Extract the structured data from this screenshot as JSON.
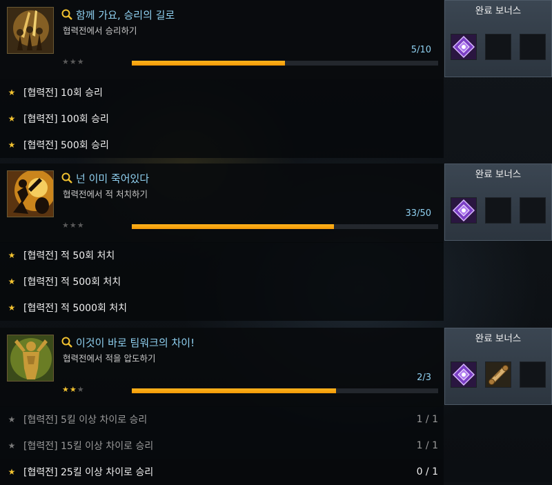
{
  "colors": {
    "accent_title": "#8fd0f0",
    "progress_fill": "#f29a08",
    "star_on": "#f2c230",
    "star_off": "#5a5a5a",
    "panel": "#2c353f"
  },
  "achievements": [
    {
      "title": "함께 가요, 승리의 길로",
      "desc": "협력전에서 승리하기",
      "count": "5/10",
      "progress": 0.5,
      "stars_earned": 0,
      "icon": "trophy-warriors-icon",
      "bonus_label": "완료 보너스",
      "rewards": [
        "purple-rune-icon",
        "empty",
        "empty"
      ],
      "subs": [
        {
          "star": "★",
          "label": "[협력전] 10회 승리",
          "progress": ""
        },
        {
          "star": "★",
          "label": "[협력전] 100회 승리",
          "progress": ""
        },
        {
          "star": "★",
          "label": "[협력전] 500회 승리",
          "progress": ""
        }
      ]
    },
    {
      "title": "넌 이미 죽어있다",
      "desc": "협력전에서 적 처치하기",
      "count": "33/50",
      "progress": 0.66,
      "stars_earned": 0,
      "icon": "explosion-fighter-icon",
      "bonus_label": "완료 보너스",
      "rewards": [
        "purple-rune-icon",
        "empty",
        "empty"
      ],
      "subs": [
        {
          "star": "★",
          "label": "[협력전] 적 50회 처치",
          "progress": ""
        },
        {
          "star": "★",
          "label": "[협력전] 적 500회 처치",
          "progress": ""
        },
        {
          "star": "★",
          "label": "[협력전] 적 5000회 처치",
          "progress": ""
        }
      ]
    },
    {
      "title": "이것이 바로 팀워크의 차이!",
      "desc": "협력전에서 적을 압도하기",
      "count": "2/3",
      "progress": 0.667,
      "stars_earned": 2,
      "icon": "golden-champion-icon",
      "bonus_label": "완료 보너스",
      "rewards": [
        "purple-rune-icon",
        "scroll-icon",
        "empty"
      ],
      "subs": [
        {
          "star": "★",
          "label": "[협력전] 5킬 이상 차이로 승리",
          "progress": "1 / 1",
          "done": true
        },
        {
          "star": "★",
          "label": "[협력전] 15킬 이상 차이로 승리",
          "progress": "1 / 1",
          "done": true
        },
        {
          "star": "★",
          "label": "[협력전] 25킬 이상 차이로 승리",
          "progress": "0 / 1",
          "done": false
        }
      ]
    }
  ]
}
